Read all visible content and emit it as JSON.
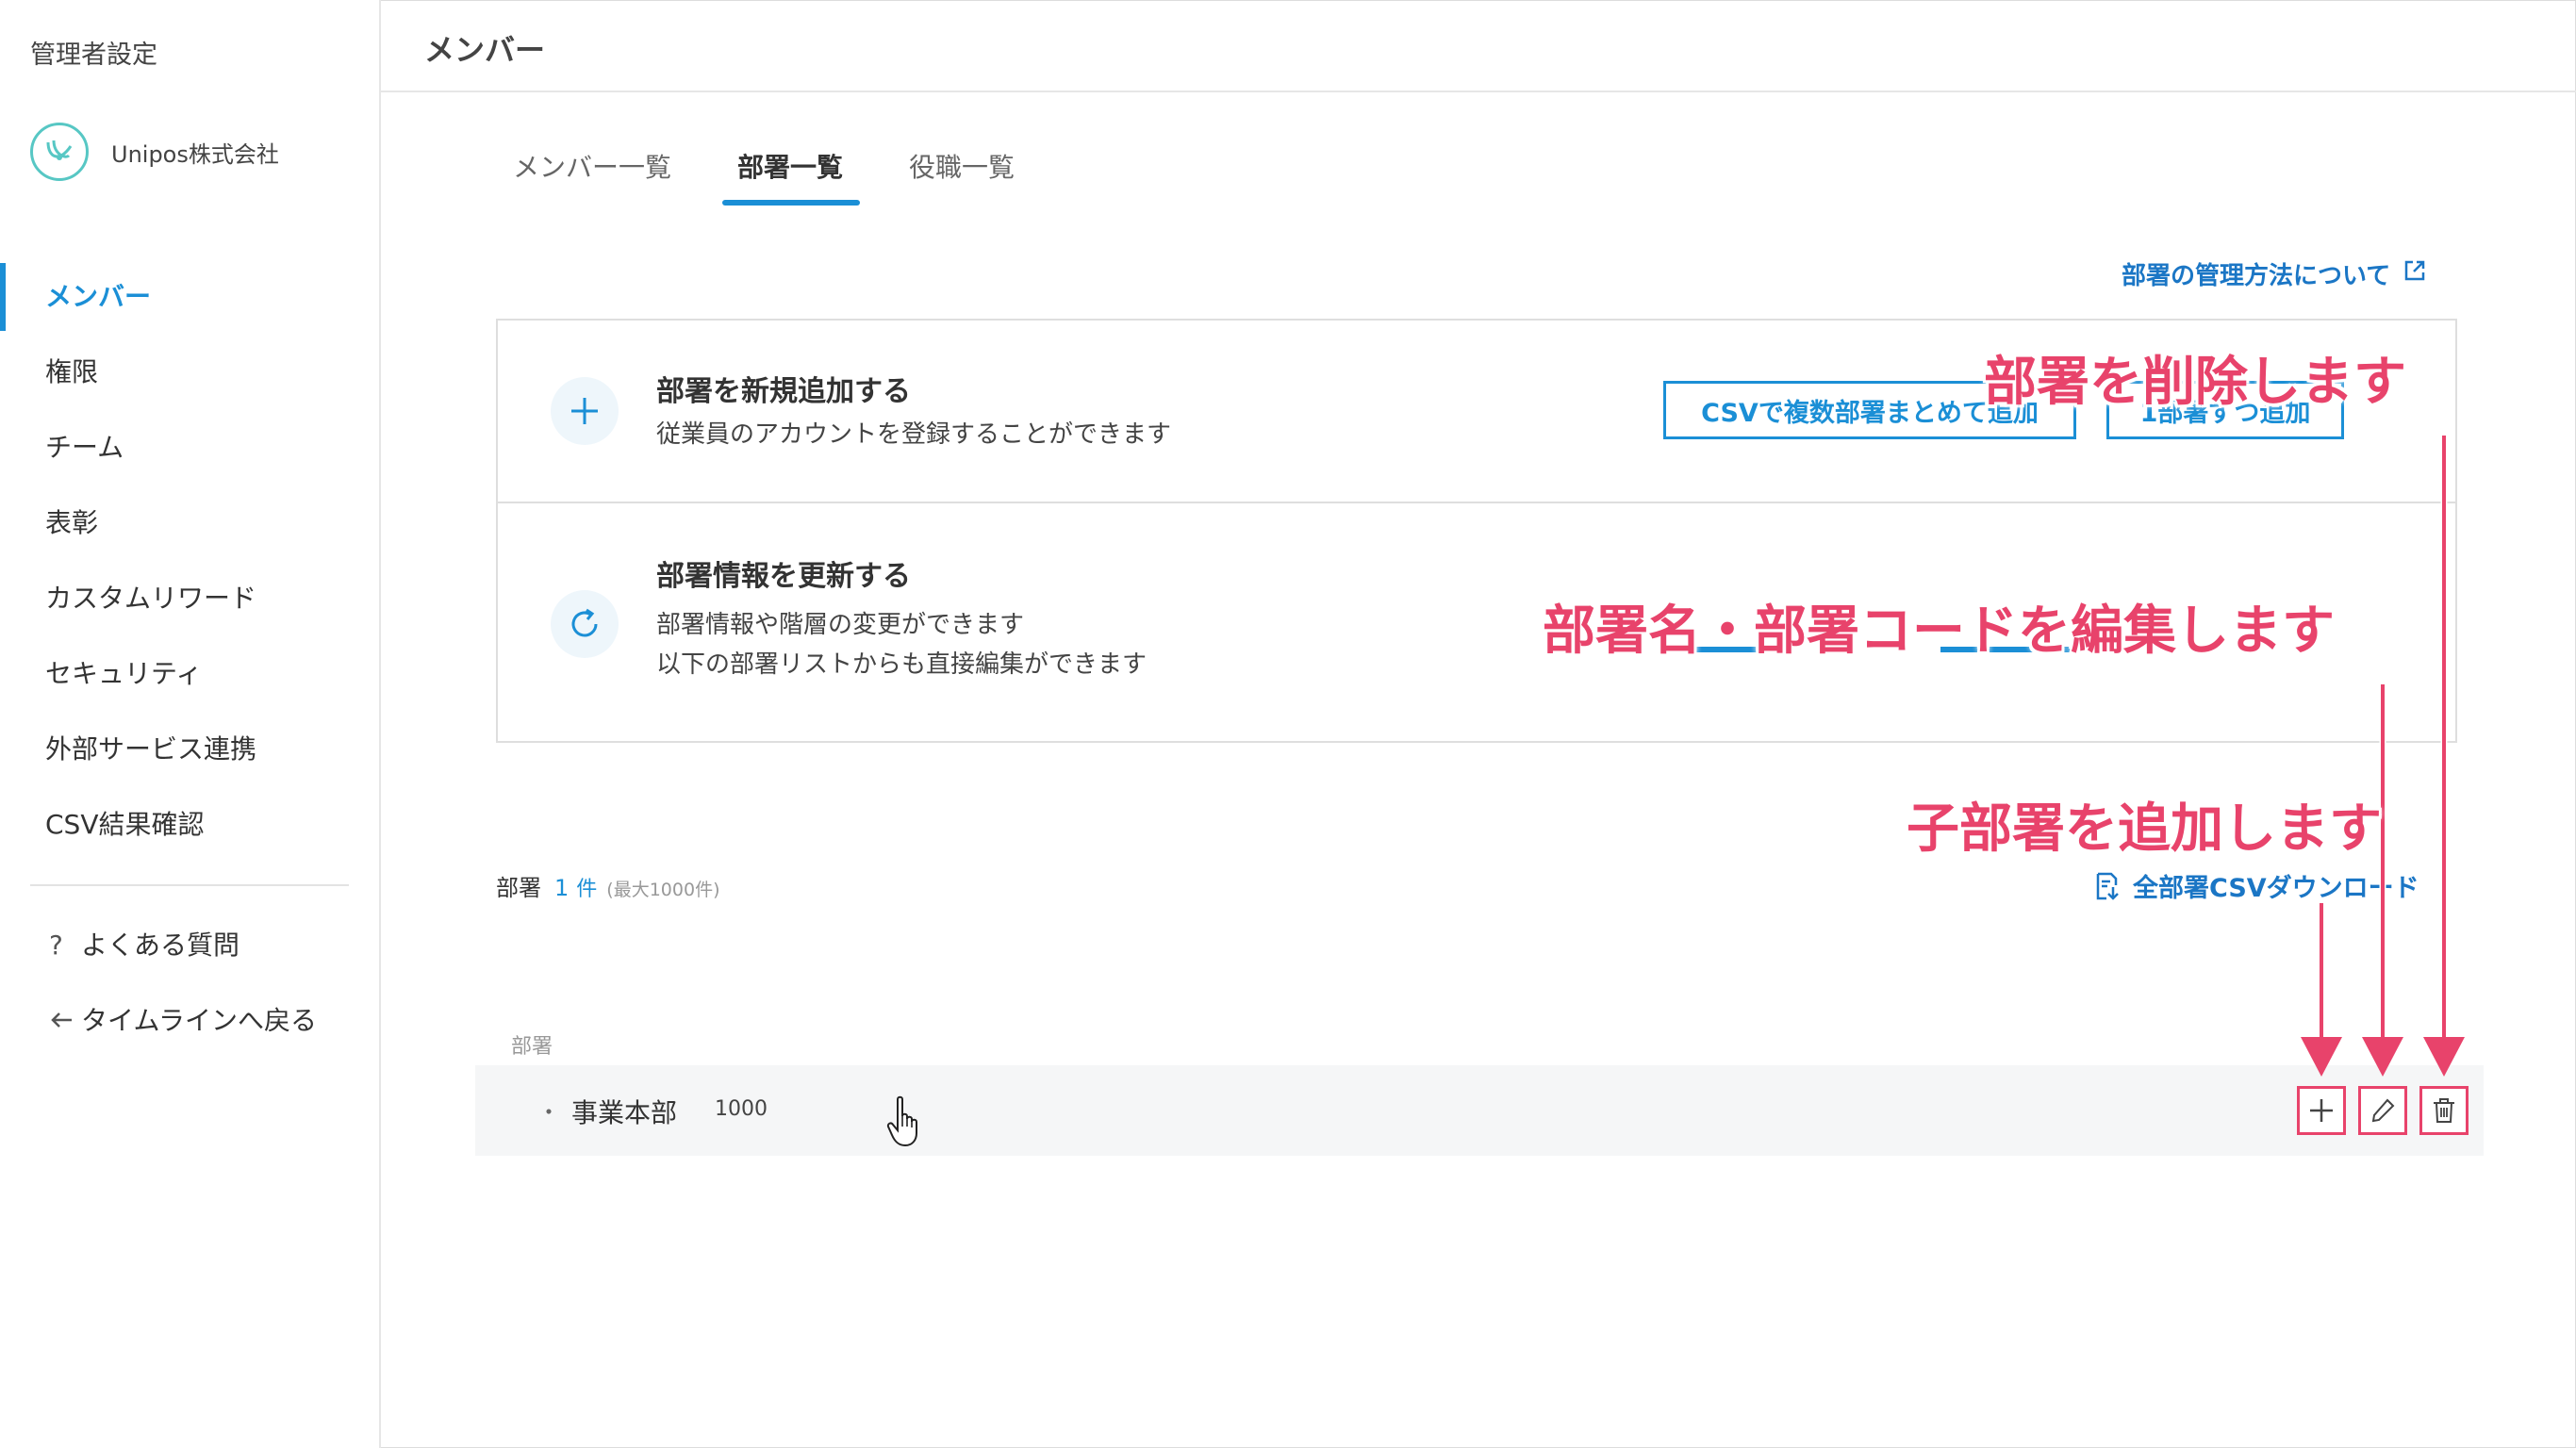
{
  "sidebar": {
    "admin_title": "管理者設定",
    "company_name": "Unipos株式会社",
    "items": [
      {
        "label": "メンバー",
        "active": true
      },
      {
        "label": "権限"
      },
      {
        "label": "チーム"
      },
      {
        "label": "表彰"
      },
      {
        "label": "カスタムリワード"
      },
      {
        "label": "セキュリティ"
      },
      {
        "label": "外部サービス連携"
      },
      {
        "label": "CSV結果確認"
      }
    ],
    "faq": "よくある質問",
    "back": "タイムラインへ戻る"
  },
  "header": {
    "title": "メンバー"
  },
  "tabs": [
    {
      "label": "メンバー一覧"
    },
    {
      "label": "部署一覧",
      "active": true
    },
    {
      "label": "役職一覧"
    }
  ],
  "help_link": "部署の管理方法について",
  "add_card": {
    "title": "部署を新規追加する",
    "desc": "従業員のアカウントを登録することができます",
    "btn_csv": "CSVで複数部署まとめて追加",
    "btn_one": "1部署ずつ追加"
  },
  "update_card": {
    "title": "部署情報を更新する",
    "desc1": "部署情報や階層の変更ができます",
    "desc2": "以下の部署リストからも直接編集ができます"
  },
  "dept_list": {
    "label": "部署",
    "count": "1",
    "unit": "件",
    "max": "(最大1000件)",
    "download": "全部署CSVダウンロード",
    "column_header": "部署",
    "rows": [
      {
        "bullet": "・",
        "name": "事業本部",
        "code": "1000"
      }
    ]
  },
  "annotations": {
    "delete": "部署を削除します",
    "edit": "部署名・部署コードを編集します",
    "add": "子部署を追加します"
  },
  "colors": {
    "accent": "#1b8fd6",
    "annotation": "#e8436b"
  }
}
